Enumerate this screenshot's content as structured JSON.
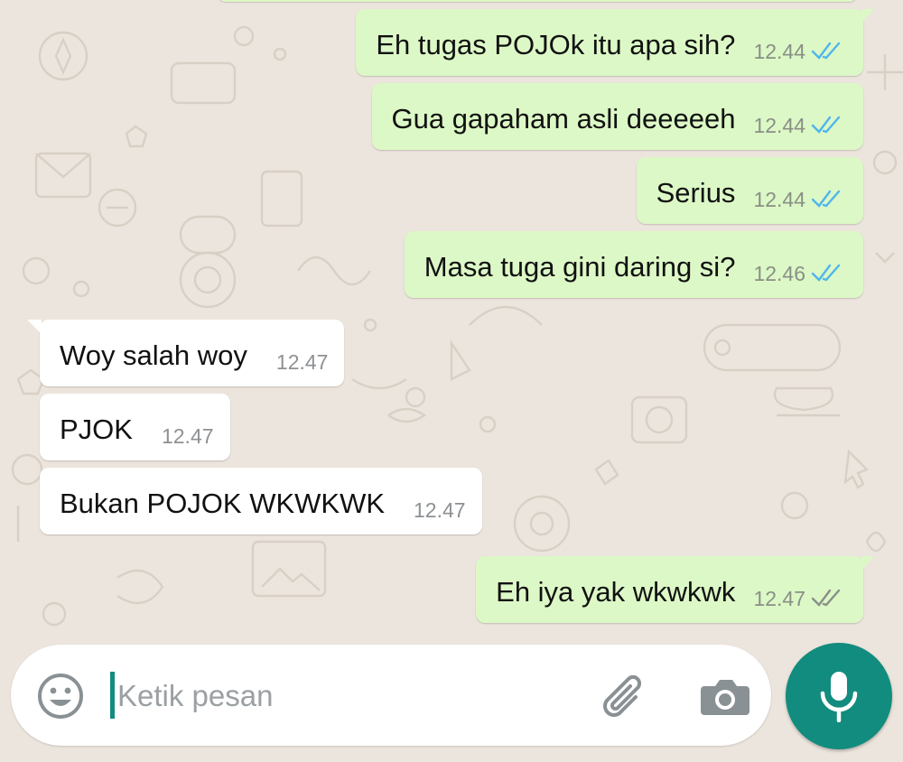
{
  "messages": [
    {
      "direction": "out",
      "text": "Eh tugas POJOk itu apa sih?",
      "time": "12.44",
      "status": "read"
    },
    {
      "direction": "out",
      "text": "Gua gapaham asli deeeeeh",
      "time": "12.44",
      "status": "read"
    },
    {
      "direction": "out",
      "text": "Serius",
      "time": "12.44",
      "status": "read"
    },
    {
      "direction": "out",
      "text": "Masa tuga gini daring si?",
      "time": "12.46",
      "status": "read"
    },
    {
      "direction": "in",
      "text": "Woy salah woy",
      "time": "12.47"
    },
    {
      "direction": "in",
      "text": "PJOK",
      "time": "12.47"
    },
    {
      "direction": "in",
      "text": "Bukan POJOK WKWKWK",
      "time": "12.47"
    },
    {
      "direction": "out",
      "text": "Eh iya yak wkwkwk",
      "time": "12.47",
      "status": "delivered"
    }
  ],
  "composer": {
    "placeholder": "Ketik pesan",
    "emoji_icon": "emoji-icon",
    "attach_icon": "paperclip-icon",
    "camera_icon": "camera-icon",
    "mic_icon": "mic-icon"
  },
  "colors": {
    "outgoing_bubble": "#dcf8c6",
    "incoming_bubble": "#ffffff",
    "read_ticks": "#4fb6ec",
    "delivered_ticks": "#8a8f86",
    "accent": "#128c7e",
    "chat_background": "#ece5dd"
  }
}
